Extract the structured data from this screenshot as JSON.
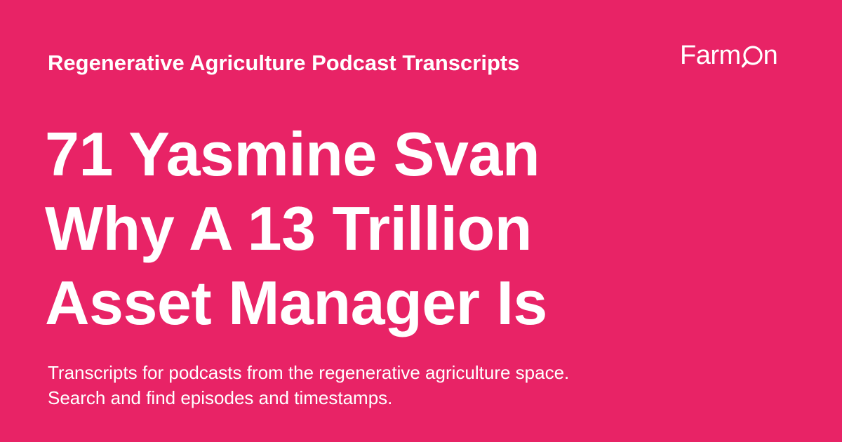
{
  "card": {
    "series_title": "Regenerative Agriculture Podcast Transcripts",
    "headline_lines": [
      "71 Yasmine Svan",
      "Why A 13 Trillion",
      "Asset Manager Is"
    ],
    "description_lines": [
      "Transcripts for podcasts from the regenerative agriculture space.",
      "Search and find episodes and timestamps."
    ]
  },
  "logo": {
    "text_start": "Farm",
    "text_end": "n",
    "icon": "magnifier-o-icon"
  },
  "colors": {
    "background": "#e82366",
    "text": "#ffffff"
  }
}
